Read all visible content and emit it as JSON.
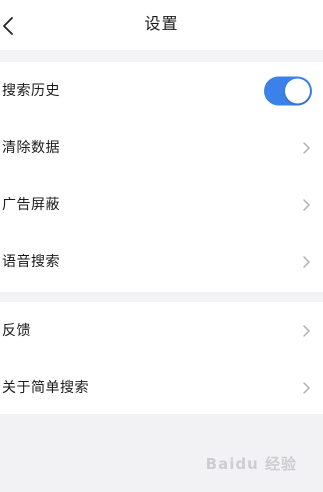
{
  "header": {
    "title": "设置",
    "back_icon": "back-arrow-icon"
  },
  "settings": {
    "group1": [
      {
        "label": "搜索历史",
        "control": "toggle",
        "toggle_on": true
      },
      {
        "label": "清除数据",
        "control": "chevron"
      },
      {
        "label": "广告屏蔽",
        "control": "chevron"
      },
      {
        "label": "语音搜索",
        "control": "chevron"
      }
    ],
    "group2": [
      {
        "label": "反馈",
        "control": "chevron"
      },
      {
        "label": "关于简单搜索",
        "control": "chevron"
      }
    ]
  },
  "colors": {
    "toggle_on": "#3b82e8",
    "page_background": "#f2f2f5",
    "chevron": "#b0b0b5"
  },
  "watermark": {
    "text": "Baidu 经验"
  }
}
